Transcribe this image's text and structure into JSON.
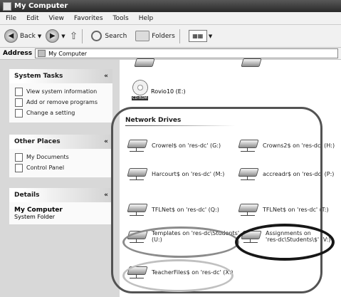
{
  "window": {
    "title": "My Computer"
  },
  "menu": [
    "File",
    "Edit",
    "View",
    "Favorites",
    "Tools",
    "Help"
  ],
  "toolbar": {
    "back": "Back",
    "search": "Search",
    "folders": "Folders"
  },
  "address": {
    "label": "Address",
    "value": "My Computer"
  },
  "system_tasks": {
    "title": "System Tasks",
    "items": [
      "View system information",
      "Add or remove programs",
      "Change a setting"
    ]
  },
  "other_places": {
    "title": "Other Places",
    "items": [
      "My Documents",
      "Control Panel"
    ]
  },
  "details": {
    "title": "Details",
    "name": "My Computer",
    "type": "System Folder"
  },
  "cd_drive": {
    "label": "Rovio10 (E:)",
    "tag": "CD-ROM"
  },
  "network": {
    "title": "Network Drives",
    "drives": [
      "Crowrel$ on 'res-dc' (G:)",
      "Crowns2$ on 'res-dc' (H:)",
      "Harcourt$ on 'res-dc' (M:)",
      "accreadr$ on 'res-dc' (P:)",
      "TFLNet$ on 'res-dc' (Q:)",
      "TFLNet$ on 'res-dc' (T:)",
      "Templates on 'res-dc\\Students'",
      "Assignments on",
      "TeacherFiles$ on 'res-dc' (X:)"
    ],
    "drives_line2": [
      "(U:)",
      "'res-dc\\Students\\$' (V:)"
    ]
  }
}
